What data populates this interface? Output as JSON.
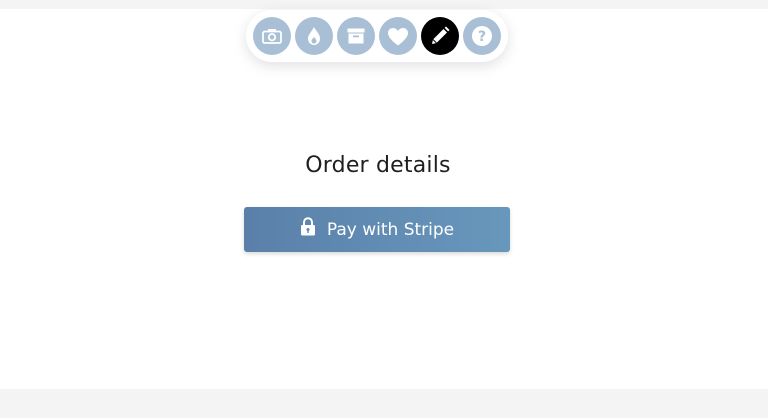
{
  "toolbar": {
    "items": [
      {
        "icon": "camera-icon",
        "active": false
      },
      {
        "icon": "flame-icon",
        "active": false
      },
      {
        "icon": "archive-icon",
        "active": false
      },
      {
        "icon": "heart-icon",
        "active": false
      },
      {
        "icon": "pencil-icon",
        "active": true
      },
      {
        "icon": "help-icon",
        "active": false
      }
    ],
    "help_glyph": "?"
  },
  "main": {
    "title": "Order details",
    "pay_button": {
      "label": "Pay with Stripe",
      "icon": "lock-icon"
    }
  },
  "colors": {
    "toolbar_button": "#a9bfd6",
    "toolbar_button_active": "#000000",
    "pay_button_start": "#5a80a9",
    "pay_button_end": "#6897bc"
  }
}
